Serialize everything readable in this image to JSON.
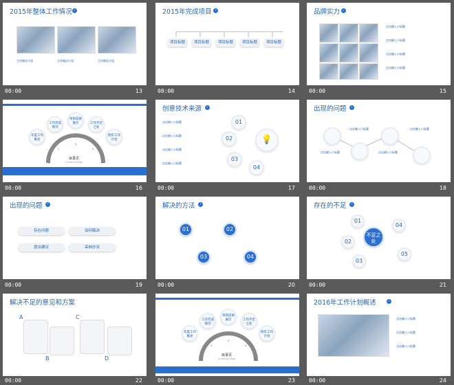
{
  "slides": [
    {
      "num": "13",
      "time": "00:00",
      "title": "2015年整体工作情况",
      "labels": [
        "工作情况介绍",
        "工作情况介绍",
        "工作情况介绍"
      ]
    },
    {
      "num": "14",
      "time": "00:00",
      "title": "2015年完成项目",
      "labels": [
        "项目标题",
        "项目标题",
        "项目标题",
        "项目标题",
        "项目标题"
      ]
    },
    {
      "num": "15",
      "time": "00:00",
      "title": "品牌实力",
      "labels": [
        "点击输入小标题",
        "点击输入小标题",
        "点击输入小标题",
        "点击输入小标题"
      ]
    },
    {
      "num": "16",
      "time": "00:00",
      "labels": [
        "年度工作概述",
        "工作完成情况",
        "项目成果展示",
        "工作不足之处",
        "明年工作计划",
        "目录页",
        "Contents Page"
      ],
      "nums": [
        "1",
        "2",
        "3",
        "4",
        "5"
      ]
    },
    {
      "num": "17",
      "time": "00:00",
      "title": "创意技术来源",
      "labels": [
        "点击输入小标题",
        "点击输入小标题",
        "点击输入小标题",
        "点击输入小标题"
      ],
      "nums": [
        "01",
        "02",
        "03",
        "04"
      ]
    },
    {
      "num": "18",
      "time": "00:00",
      "title": "出现的问题",
      "labels": [
        "点击输入小标题",
        "点击输入小标题",
        "点击输入小标题",
        "点击输入小标题"
      ]
    },
    {
      "num": "19",
      "time": "00:00",
      "title": "出现的问题",
      "labels": [
        "存在问题",
        "如何解决",
        "提出建议",
        "采纳办法"
      ]
    },
    {
      "num": "20",
      "time": "00:00",
      "title": "解决的方法",
      "nums": [
        "01",
        "02",
        "03",
        "04"
      ]
    },
    {
      "num": "21",
      "time": "00:00",
      "title": "存在的不足",
      "center": "不足之处",
      "nums": [
        "01",
        "02",
        "03",
        "04",
        "05"
      ]
    },
    {
      "num": "22",
      "time": "00:00",
      "title": "解决不足的意见和方案",
      "letters": [
        "A",
        "B",
        "C",
        "D"
      ]
    },
    {
      "num": "23",
      "time": "00:00",
      "labels": [
        "年度工作概述",
        "工作完成情况",
        "项目成果展示",
        "工作不足之处",
        "明年工作计划",
        "目录页",
        "Contents Page"
      ],
      "nums": [
        "1",
        "2",
        "3",
        "4",
        "5"
      ]
    },
    {
      "num": "24",
      "time": "00:00",
      "title": "2016年工作计划概述",
      "labels": [
        "点击输入小标题",
        "点击输入小标题",
        "点击输入小标题"
      ]
    }
  ]
}
